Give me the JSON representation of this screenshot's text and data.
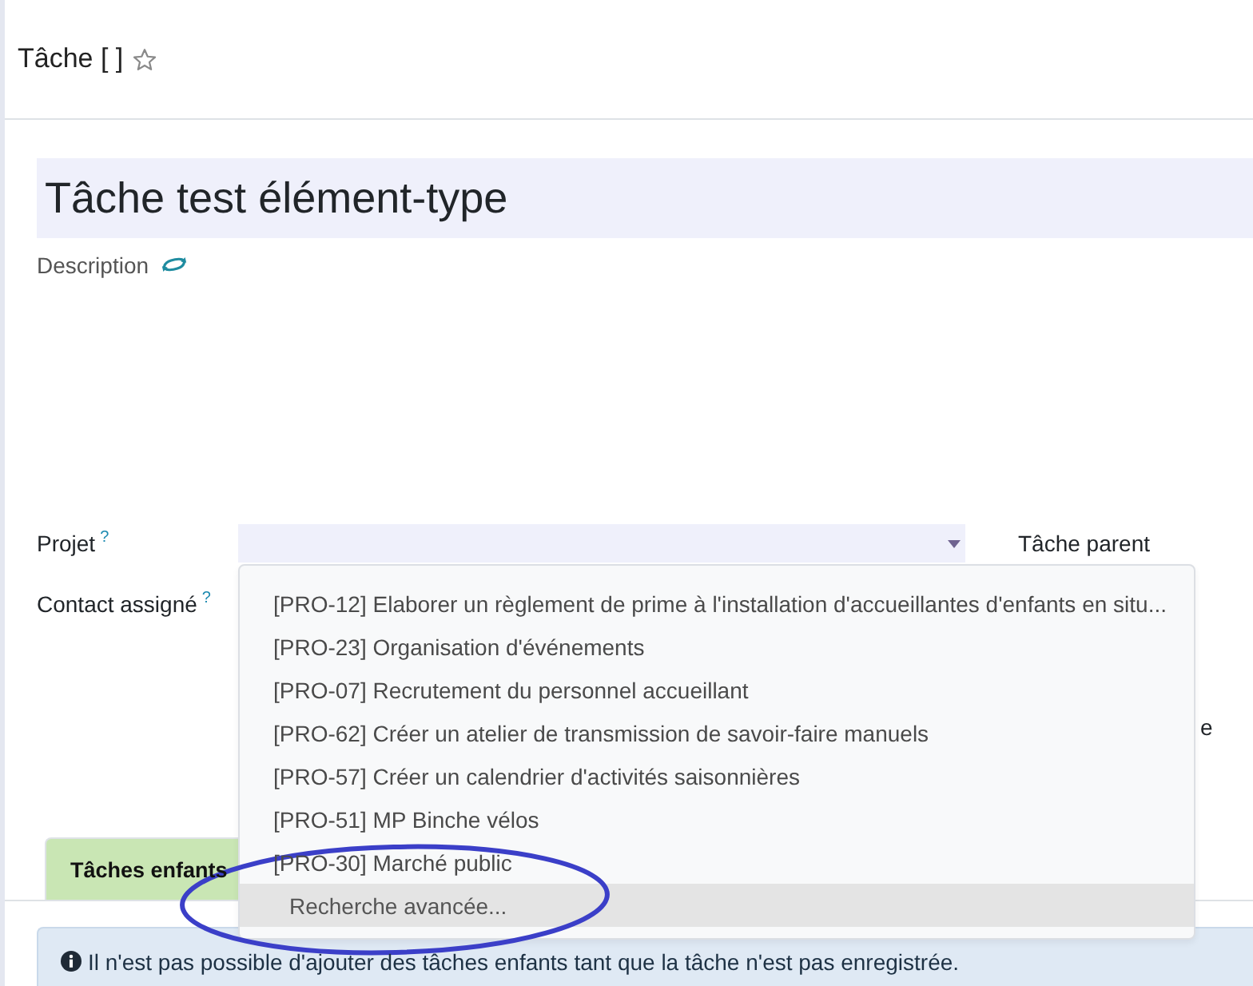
{
  "header": {
    "title": "Tâche [ ]",
    "starred": false
  },
  "record": {
    "name": "Tâche test élément-type"
  },
  "description": {
    "label": "Description"
  },
  "fields": [
    {
      "label": "Projet",
      "help": "?",
      "kind": "select"
    },
    {
      "label": "Contact assigné",
      "help": "?",
      "kind": "hidden"
    }
  ],
  "side_labels": [
    {
      "text": "Tâche parent"
    },
    {
      "text": "e"
    }
  ],
  "dropdown": {
    "options": [
      {
        "label": "[PRO-12] Elaborer un règlement de prime à l'installation d'accueillantes d'enfants en situ...",
        "kind": "record",
        "highlighted": false,
        "circled": false
      },
      {
        "label": "[PRO-23] Organisation d'événements",
        "kind": "record",
        "highlighted": false,
        "circled": false
      },
      {
        "label": "[PRO-07] Recrutement du personnel accueillant",
        "kind": "record",
        "highlighted": false,
        "circled": false
      },
      {
        "label": "[PRO-62] Créer un atelier de transmission de savoir-faire manuels",
        "kind": "record",
        "highlighted": false,
        "circled": false
      },
      {
        "label": "[PRO-57] Créer un calendrier d'activités saisonnières",
        "kind": "record",
        "highlighted": false,
        "circled": false
      },
      {
        "label": "[PRO-51] MP Binche vélos",
        "kind": "record",
        "highlighted": false,
        "circled": false
      },
      {
        "label": "[PRO-30] Marché public",
        "kind": "record",
        "highlighted": false,
        "circled": false
      },
      {
        "label": "Recherche avancée...",
        "kind": "action",
        "highlighted": true,
        "circled": true
      }
    ]
  },
  "tabs": [
    {
      "label": "Tâches enfants",
      "selected": true
    }
  ],
  "alert": {
    "text": "Il n'est pas possible d'ajouter des tâches enfants tant que la tâche n'est pas enregistrée."
  }
}
